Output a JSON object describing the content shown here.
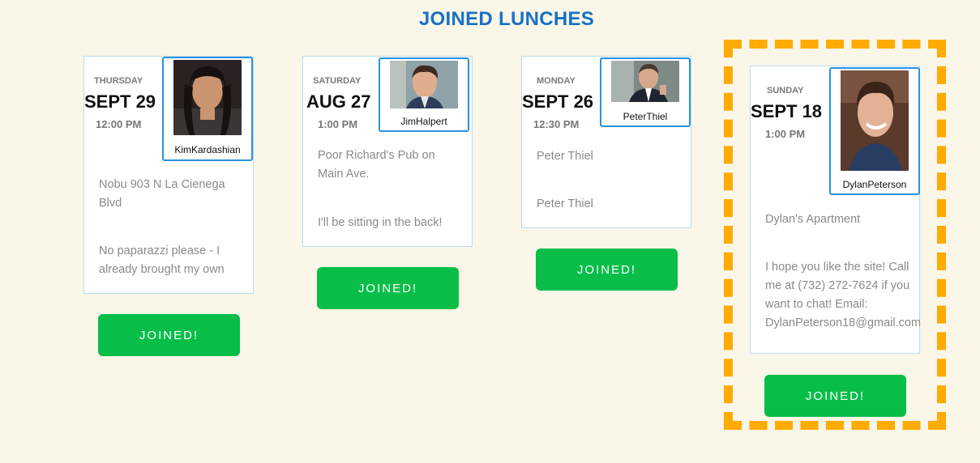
{
  "page": {
    "title": "JOINED LUNCHES"
  },
  "lunches": [
    {
      "day": "THURSDAY",
      "date": "SEPT 29",
      "time": "12:00 PM",
      "host": "KimKardashian",
      "location": "Nobu 903 N La Cienega Blvd",
      "note": "No paparazzi please - I already brought my own",
      "button": "JOINED!"
    },
    {
      "day": "SATURDAY",
      "date": "AUG 27",
      "time": "1:00 PM",
      "host": "JimHalpert",
      "location": "Poor Richard's Pub on Main Ave.",
      "note": "I'll be sitting in the back!",
      "button": "JOINED!"
    },
    {
      "day": "MONDAY",
      "date": "SEPT 26",
      "time": "12:30 PM",
      "host": "PeterThiel",
      "location": "Peter Thiel",
      "note": "Peter Thiel",
      "button": "JOINED!"
    },
    {
      "day": "SUNDAY",
      "date": "SEPT 18",
      "time": "1:00 PM",
      "host": "DylanPeterson",
      "location": "Dylan's Apartment",
      "note": "I hope you like the site! Call me at (732) 272-7624 if you want to chat! Email: DylanPeterson18@gmail.com",
      "button": "JOINED!"
    }
  ],
  "colors": {
    "background": "#faf6e8",
    "title": "#1771c4",
    "button": "#08be49",
    "host_border": "#2a92e0",
    "highlight": "#ffab00"
  }
}
